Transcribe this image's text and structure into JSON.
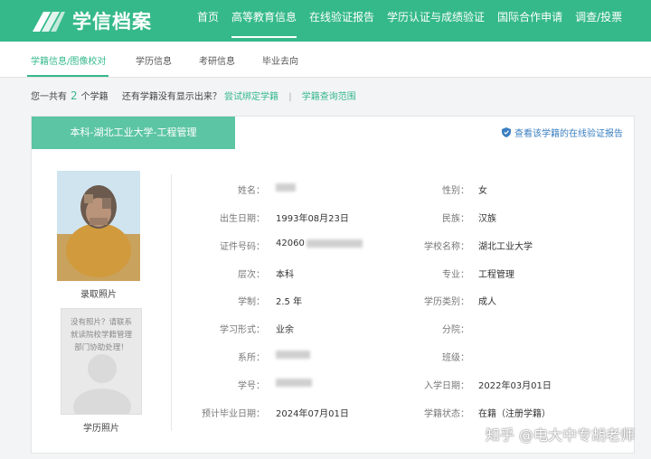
{
  "header": {
    "logo_text": "学信档案",
    "nav": [
      {
        "label": "首页",
        "active": false
      },
      {
        "label": "高等教育信息",
        "active": true
      },
      {
        "label": "在线验证报告",
        "active": false
      },
      {
        "label": "学历认证与成绩验证",
        "active": false
      },
      {
        "label": "国际合作申请",
        "active": false
      },
      {
        "label": "调查/投票",
        "active": false
      }
    ]
  },
  "subnav": [
    {
      "label": "学籍信息/图像校对",
      "active": true
    },
    {
      "label": "学历信息",
      "active": false
    },
    {
      "label": "考研信息",
      "active": false
    },
    {
      "label": "毕业去向",
      "active": false
    }
  ],
  "summary": {
    "prefix": "您一共有",
    "count": "2",
    "suffix": "个学籍",
    "missing_text": "还有学籍没有显示出来？",
    "bind_link": "尝试绑定学籍",
    "scope_link": "学籍查询范围"
  },
  "record": {
    "tab_label": "本科-湖北工业大学-工程管理",
    "verify_link": "查看该学籍的在线验证报告",
    "photo1_caption": "录取照片",
    "photo2_text": "没有照片？请联系就读院校学籍管理部门协助处理！",
    "photo2_caption": "学历照片",
    "left_fields": [
      {
        "label": "姓名：",
        "value": ""
      },
      {
        "label": "出生日期：",
        "value": "1993年08月23日"
      },
      {
        "label": "证件号码：",
        "value": "42060"
      },
      {
        "label": "层次：",
        "value": "本科"
      },
      {
        "label": "学制：",
        "value": "2.5 年"
      },
      {
        "label": "学习形式：",
        "value": "业余"
      },
      {
        "label": "系所：",
        "value": ""
      },
      {
        "label": "学号：",
        "value": ""
      },
      {
        "label": "预计毕业日期：",
        "value": "2024年07月01日"
      }
    ],
    "right_fields": [
      {
        "label": "性别：",
        "value": "女"
      },
      {
        "label": "民族：",
        "value": "汉族"
      },
      {
        "label": "学校名称：",
        "value": "湖北工业大学"
      },
      {
        "label": "专业：",
        "value": "工程管理"
      },
      {
        "label": "学历类别：",
        "value": "成人"
      },
      {
        "label": "分院：",
        "value": ""
      },
      {
        "label": "班级：",
        "value": ""
      },
      {
        "label": "入学日期：",
        "value": "2022年03月01日"
      },
      {
        "label": "学籍状态：",
        "value": "在籍（注册学籍）"
      }
    ]
  },
  "watermark": "知乎 @电大中专胡老师",
  "colors": {
    "brand": "#35b98b",
    "tab": "#5cc5a3",
    "link": "#3a7fc1"
  }
}
